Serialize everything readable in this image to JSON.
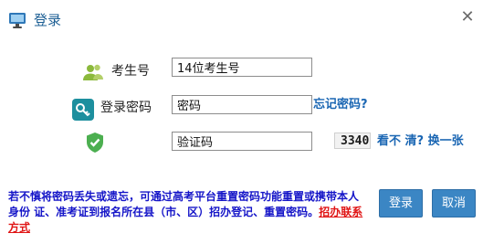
{
  "window": {
    "title": "登录",
    "close_label": "✕"
  },
  "form": {
    "candidate_label": "考生号",
    "candidate_value": "14位考生号",
    "password_label": "登录密码",
    "password_value": "密码",
    "forgot_password": "忘记密码?",
    "captcha_value": "验证码",
    "captcha_image_text": "3340",
    "refresh_captcha": "看不 清? 换一张"
  },
  "notice": {
    "text": "若不慎将密码丢失或遗忘，可通过高考平台重置密码功能重置或携带本人身份 证、准考证到报名所在县（市、区）招办登记、重置密码。",
    "contact_link": "招办联系方式"
  },
  "buttons": {
    "login": "登录",
    "cancel": "取消"
  },
  "colors": {
    "accent": "#3b86c4",
    "link": "#1a66b3",
    "notice": "#1515c8",
    "warning_link": "#e01515"
  }
}
